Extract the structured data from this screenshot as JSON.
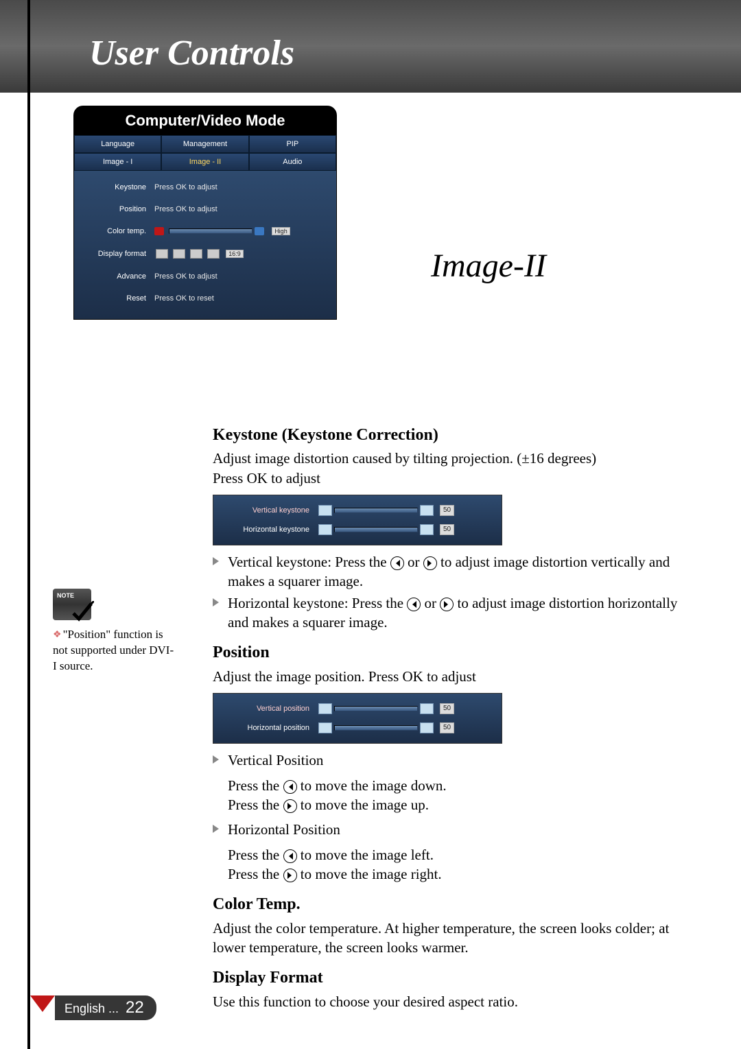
{
  "header": {
    "title": "User Controls"
  },
  "osdMain": {
    "title": "Computer/Video Mode",
    "tabsTop": [
      "Language",
      "Management",
      "PIP"
    ],
    "tabsBottom": [
      "Image - I",
      "Image - II",
      "Audio"
    ],
    "activeTab": "Image - II",
    "rows": {
      "keystone": {
        "label": "Keystone",
        "value": "Press OK to adjust"
      },
      "position": {
        "label": "Position",
        "value": "Press OK to adjust"
      },
      "colorTemp": {
        "label": "Color temp.",
        "badge": "High"
      },
      "displayFormat": {
        "label": "Display format",
        "badge": "16:9"
      },
      "advance": {
        "label": "Advance",
        "value": "Press OK to adjust"
      },
      "reset": {
        "label": "Reset",
        "value": "Press OK to reset"
      }
    }
  },
  "sectionTitle": "Image-II",
  "keystone": {
    "heading": "Keystone (Keystone Correction)",
    "desc1": "Adjust image distortion caused by tilting projection. (±16 degrees)",
    "desc2": "Press OK to adjust",
    "rows": {
      "vertical": {
        "label": "Vertical keystone",
        "value": "50"
      },
      "horizontal": {
        "label": "Horizontal keystone",
        "value": "50"
      }
    },
    "bullets": {
      "v1": "Vertical keystone: Press the ",
      "v2": " or ",
      "v3": " to adjust image distortion vertically and makes a squarer image.",
      "h1": "Horizontal keystone: Press the ",
      "h2": " or ",
      "h3": " to adjust image distortion horizontally and makes a squarer image."
    }
  },
  "position": {
    "heading": "Position",
    "desc": "Adjust the image position. Press OK to adjust",
    "rows": {
      "vertical": {
        "label": "Vertical position",
        "value": "50"
      },
      "horizontal": {
        "label": "Horizontal position",
        "value": "50"
      }
    },
    "bullets": {
      "vHead": "Vertical Position",
      "vDown1": "Press the ",
      "vDown2": " to move the image down.",
      "vUp1": "Press the ",
      "vUp2": " to move the image up.",
      "hHead": "Horizontal Position",
      "hLeft1": "Press the ",
      "hLeft2": " to move the image left.",
      "hRight1": "Press the ",
      "hRight2": " to move the image right."
    }
  },
  "colorTemp": {
    "heading": "Color Temp.",
    "desc": "Adjust the color temperature. At higher temperature, the screen looks colder; at lower temperature, the screen looks warmer."
  },
  "displayFormat": {
    "heading": "Display Format",
    "desc": "Use this function to choose your desired aspect ratio."
  },
  "note": {
    "badge": "NOTE",
    "text": "\"Position\" function is not supported under DVI-I source."
  },
  "footer": {
    "lang": "English ...",
    "page": "22"
  }
}
